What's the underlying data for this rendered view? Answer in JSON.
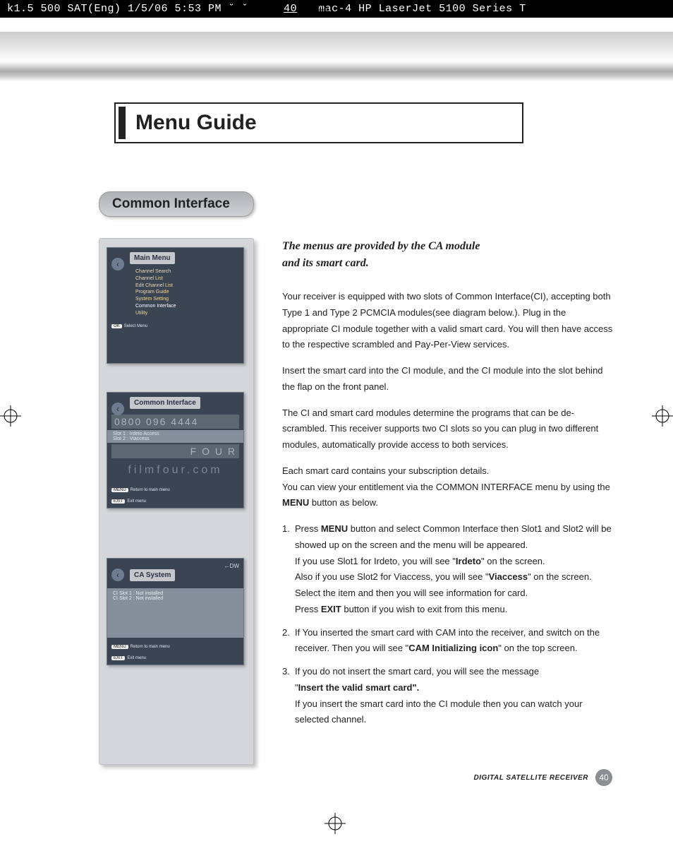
{
  "print_header": {
    "left": "k1.5 500 SAT(Eng)  1/5/06 5:53 PM  ˘   ˇ",
    "page": "40",
    "right": "mac-4 HP LaserJet 5100 Series  T"
  },
  "title": "Menu Guide",
  "section": "Common Interface",
  "thumbs": {
    "t1": {
      "title": "Main Menu",
      "items": [
        "Channel Search",
        "Channel List",
        "Edit Channel List",
        "Program Guide",
        "System Setting",
        "Common Interface",
        "Utility"
      ],
      "highlight_index": 5,
      "foot_btn": "OK",
      "foot_text": "Select Menu"
    },
    "t2": {
      "title": "Common Interface",
      "band1": "0800 096 4444",
      "slot1": "Slot 1 : Irdeto Access",
      "slot2": "Slot 2 : Viaccess",
      "ghost1": "F O U R",
      "ghost2": "filmfour.com",
      "foot1_btn": "MENU",
      "foot1_text": "Return to main menu",
      "foot2_btn": "EXIT",
      "foot2_text": "Exit menu"
    },
    "t3": {
      "title": "CA System",
      "hint": "DW",
      "row1": "CI Slot 1 : Not installed",
      "row2": "CI Slot 2 : Not installed",
      "foot1_btn": "MENU",
      "foot1_text": "Return to main menu",
      "foot2_btn": "EXIT",
      "foot2_text": "Exit menu"
    }
  },
  "intro_l1": "The menus are provided by the CA module",
  "intro_l2": "and its smart card.",
  "p1": "Your receiver is equipped with two slots of Common Interface(CI), accepting both Type 1 and Type 2 PCMCIA modules(see diagram below.). Plug in the appropriate CI module together with a valid smart card. You will then have access to the respective scrambled and Pay-Per-View services.",
  "p2": "Insert the smart card into the CI module, and the CI module into the slot behind the flap on the front panel.",
  "p3": "The CI and smart card modules determine the programs that can be de-scrambled. This receiver supports two CI slots so you can plug in two different modules, automatically provide access to both services.",
  "p4a": "Each smart card contains your subscription details.",
  "p4b_pre": "You can view your entitlement via the COMMON INTERFACE menu by using the ",
  "p4b_bold": "MENU",
  "p4b_post": " button as below.",
  "li1": {
    "num": "1.",
    "a_pre": "Press ",
    "a_bold": "MENU",
    "a_post": " button and select Common Interface then Slot1 and Slot2 will be showed up on the screen and the menu will be appeared.",
    "b_pre": "If you use Slot1 for Irdeto, you will see \"",
    "b_bold": "Irdeto",
    "b_post": "\" on the screen.",
    "c_pre": "Also if you use Slot2 for Viaccess, you will see \"",
    "c_bold": "Viaccess",
    "c_post": "\" on the screen.",
    "d": "Select the item and then you will see information for card.",
    "e_pre": "Press ",
    "e_bold": "EXIT",
    "e_post": " button if you wish to exit from this menu."
  },
  "li2": {
    "num": "2.",
    "a_pre": "If You inserted the smart card with CAM into the receiver, and switch on the receiver. Then you will see \"",
    "a_bold": "CAM Initializing icon",
    "a_post": "\" on the top screen."
  },
  "li3": {
    "num": "3.",
    "a": "If you do not insert the smart card, you will see the message",
    "b_pre": "\"",
    "b_bold": "Insert the valid smart card\".",
    "c": "If you insert the smart card into the CI module then you can watch your selected channel."
  },
  "footer_label": "DIGITAL SATELLITE RECEIVER",
  "page_number": "40"
}
